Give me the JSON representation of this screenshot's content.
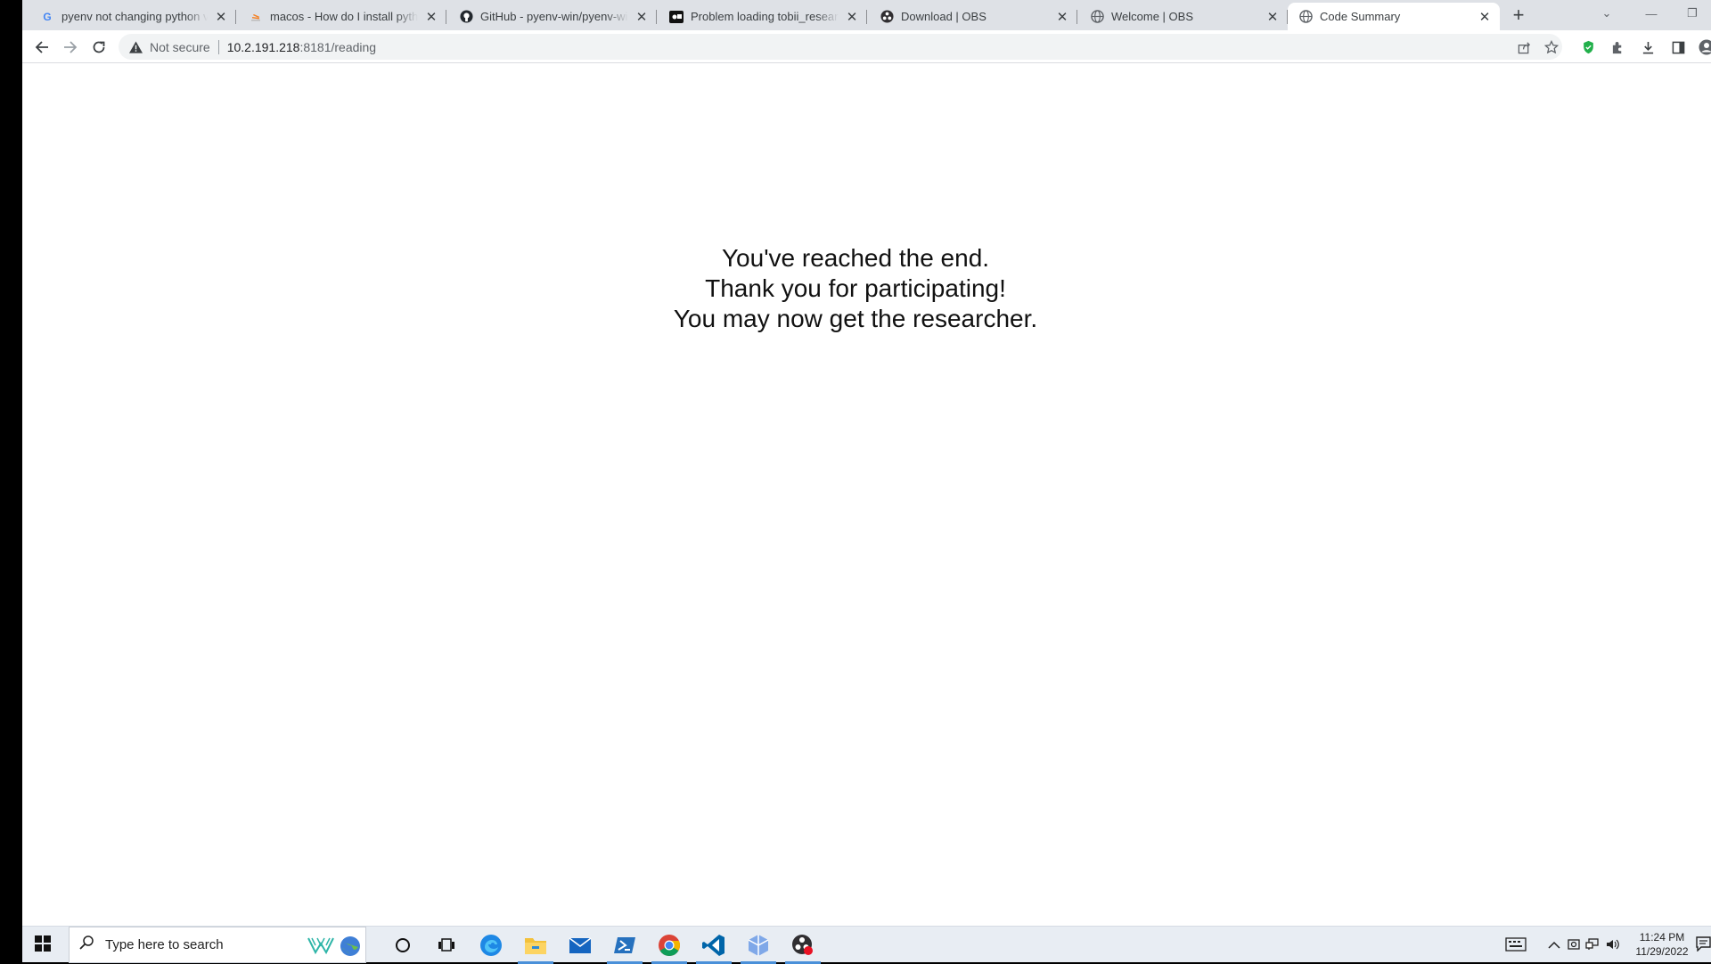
{
  "browser": {
    "tabs": [
      {
        "title": "pyenv not changing python version",
        "favicon": "google-icon",
        "active": false
      },
      {
        "title": "macos - How do I install python",
        "favicon": "stackoverflow-icon",
        "active": false
      },
      {
        "title": "GitHub - pyenv-win/pyenv-win: ",
        "favicon": "github-icon",
        "active": false
      },
      {
        "title": "Problem loading tobii_research",
        "favicon": "site-icon",
        "active": false
      },
      {
        "title": "Download | OBS",
        "favicon": "obs-icon",
        "active": false
      },
      {
        "title": "Welcome | OBS",
        "favicon": "globe-icon",
        "active": false
      },
      {
        "title": "Code Summary",
        "favicon": "globe-icon",
        "active": true
      }
    ],
    "address": {
      "security_label": "Not secure",
      "host": "10.2.191.218",
      "rest": ":8181/reading"
    }
  },
  "page": {
    "lines": [
      "You've reached the end.",
      "Thank you for participating!",
      "You may now get the researcher."
    ]
  },
  "taskbar": {
    "search_placeholder": "Type here to search",
    "time": "11:24 PM",
    "date": "11/29/2022"
  },
  "colors": {
    "edge_blue": "#1e88e5",
    "chrome_red": "#db4437",
    "chrome_green": "#0f9d58",
    "chrome_yellow": "#f4b400",
    "vscode_blue": "#0065a9",
    "taskbar_bg": "#e8edf3"
  }
}
